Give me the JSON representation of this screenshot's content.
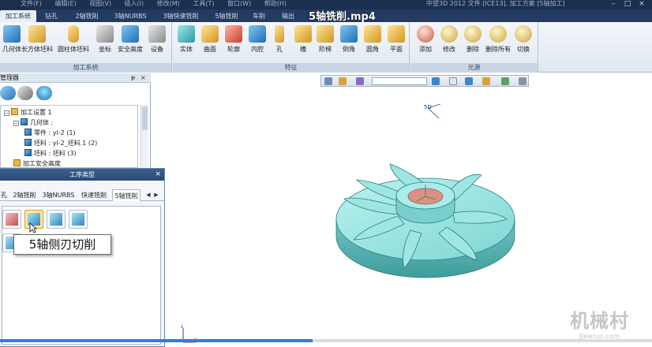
{
  "titlebar": {
    "menu": [
      "文件(F)",
      "编辑(E)",
      "视图(V)",
      "插入(I)",
      "修改(M)",
      "工具(T)",
      "窗口(W)",
      "帮助(H)"
    ],
    "app_title": "中望3D 2012     文件 [ICE13], 加工方案 [5轴加工]"
  },
  "video_title": "5轴铣削.mp4",
  "ribbon": {
    "tabs": [
      "加工系统",
      "钻孔",
      "2轴铣削",
      "3轴NURBS",
      "3轴快速铣削",
      "5轴铣削",
      "车削",
      "输出"
    ],
    "active_tab": "加工系统",
    "groups": [
      {
        "label": "加工系统",
        "buttons": [
          "几何体",
          "长方体坯料",
          "圆柱体坯料",
          "坐标",
          "安全高度",
          "设备"
        ]
      },
      {
        "label": "特征",
        "buttons": [
          "实体",
          "曲面",
          "轮廓",
          "内腔",
          "孔",
          "槽",
          "阶梯",
          "倒角",
          "圆角",
          "平面"
        ]
      },
      {
        "label": "光源",
        "buttons": [
          "添加",
          "修改",
          "删除",
          "删除所有",
          "切换"
        ]
      }
    ]
  },
  "manager": {
    "title": "管理器",
    "pin": "ᵽ",
    "close": "×",
    "tree": [
      {
        "label": "加工设置 1",
        "level": 0,
        "icon": "folder-icon",
        "toggle": "−"
      },
      {
        "label": "几何体 :",
        "level": 1,
        "icon": "cube-icon",
        "toggle": "−"
      },
      {
        "label": "零件 : yl-2 (1)",
        "level": 2,
        "icon": "cube-icon",
        "toggle": ""
      },
      {
        "label": "坯料 : yl-2_坯料.1 (2)",
        "level": 2,
        "icon": "cube-icon",
        "toggle": ""
      },
      {
        "label": "坯料 : 坯料 (3)",
        "level": 2,
        "icon": "cube-icon",
        "toggle": ""
      },
      {
        "label": "加工安全高度",
        "level": 1,
        "icon": "folder-icon",
        "toggle": ""
      }
    ]
  },
  "dialog": {
    "title": "工序类型",
    "close": "×",
    "tabs": [
      "孔",
      "2轴铣削",
      "3轴NURBS",
      "快速铣削",
      "5轴铣削"
    ],
    "active_tab": "5轴铣削",
    "tooltip": "5轴侧刃切削"
  },
  "viewport": {
    "view_label": "5D",
    "axis_x": "x",
    "axis_z": "z"
  },
  "playback": {
    "progress": 0.48
  },
  "watermark": {
    "text": "机械村",
    "sub": "Jixiecun.com"
  },
  "colors": {
    "part": "#8ee0de",
    "part_dark": "#3f9d9c",
    "hub_face": "#dd8f86",
    "ribbon_bar": "#233b61",
    "progress": "#2f7de0"
  }
}
